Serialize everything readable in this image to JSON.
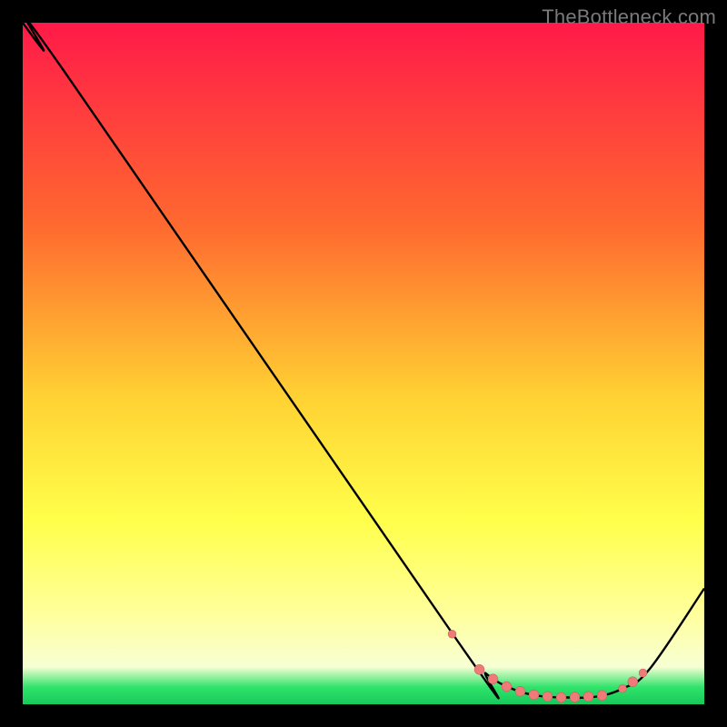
{
  "watermark": "TheBottleneck.com",
  "colors": {
    "bg_black": "#000000",
    "curve_stroke": "#000000",
    "marker_fill": "#ef7b79",
    "marker_stroke": "#c96463",
    "grad_top": "#ff1a49",
    "grad_mid1": "#ff6a2f",
    "grad_mid2": "#ffd233",
    "grad_mid3": "#ffff4a",
    "grad_yellow_light": "#ffff9e",
    "grad_pale": "#f7ffd4",
    "grad_green": "#2fe36a",
    "grad_green2": "#18c95a"
  },
  "chart_data": {
    "type": "line",
    "title": "",
    "xlabel": "",
    "ylabel": "",
    "xlim": [
      0,
      100
    ],
    "ylim": [
      0,
      100
    ],
    "series": [
      {
        "name": "curve",
        "x": [
          0,
          3,
          6,
          64,
          68,
          72,
          76,
          80,
          84,
          88,
          92,
          100
        ],
        "y": [
          100,
          96,
          93,
          9,
          4.5,
          2.2,
          1.2,
          1.0,
          1.1,
          2.3,
          5.2,
          17
        ]
      }
    ],
    "markers": {
      "name": "highlight-points",
      "x": [
        63,
        67,
        69,
        71,
        73,
        75,
        77,
        79,
        81,
        83,
        85,
        88,
        89.5,
        91
      ],
      "y": [
        10.3,
        5.1,
        3.7,
        2.6,
        1.9,
        1.4,
        1.15,
        1.0,
        1.05,
        1.15,
        1.3,
        2.3,
        3.3,
        4.6
      ],
      "r": [
        4.4,
        5.4,
        5.4,
        5.4,
        5.4,
        5.4,
        5.4,
        5.4,
        5.4,
        5.4,
        5.4,
        4.4,
        5.4,
        4.4
      ]
    }
  }
}
